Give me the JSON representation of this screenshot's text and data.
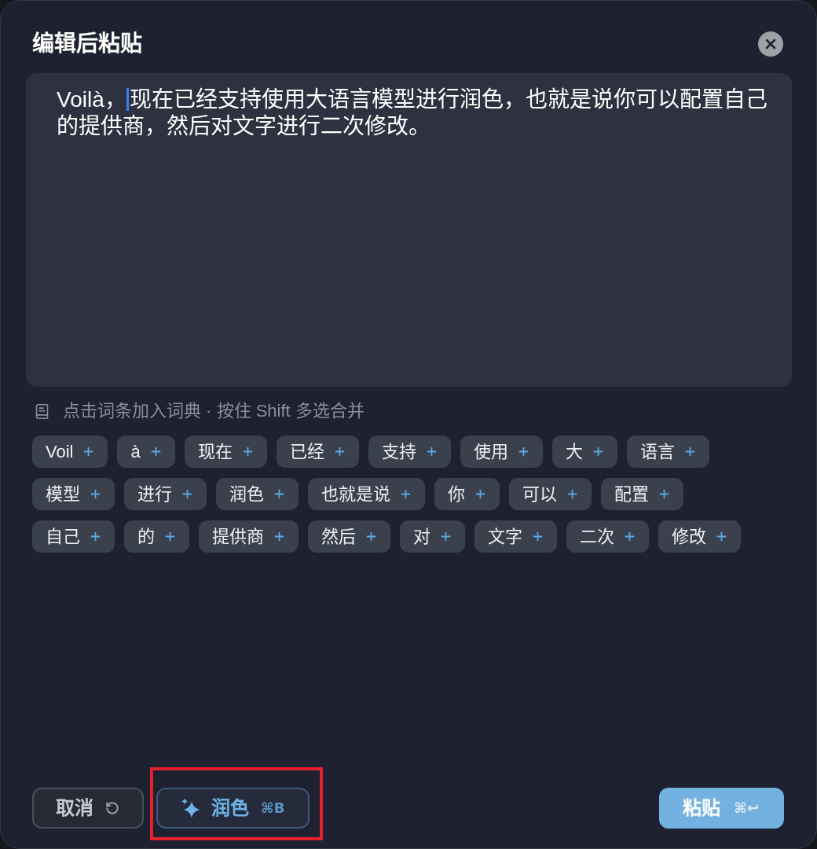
{
  "dialog": {
    "title": "编辑后粘贴"
  },
  "editor": {
    "value_before_caret": "Voilà，",
    "value_after_caret": "现在已经支持使用大语言模型进行润色，也就是说你可以配置自己的提供商，然后对文字进行二次修改。",
    "focused": true
  },
  "hint": "点击词条加入词典 · 按住 Shift 多选合并",
  "tokens": [
    "Voil",
    "à",
    "现在",
    "已经",
    "支持",
    "使用",
    "大",
    "语言",
    "模型",
    "进行",
    "润色",
    "也就是说",
    "你",
    "可以",
    "配置",
    "自己",
    "的",
    "提供商",
    "然后",
    "对",
    "文字",
    "二次",
    "修改"
  ],
  "buttons": [
    {
      "kind": "cancel",
      "label": "取消",
      "highlighted": false
    },
    {
      "kind": "polish",
      "label": "润色",
      "shortcut": "⌘B",
      "highlighted": true
    },
    {
      "kind": "paste",
      "label": "粘贴",
      "shortcut": "⌘↩",
      "highlighted": false
    }
  ]
}
